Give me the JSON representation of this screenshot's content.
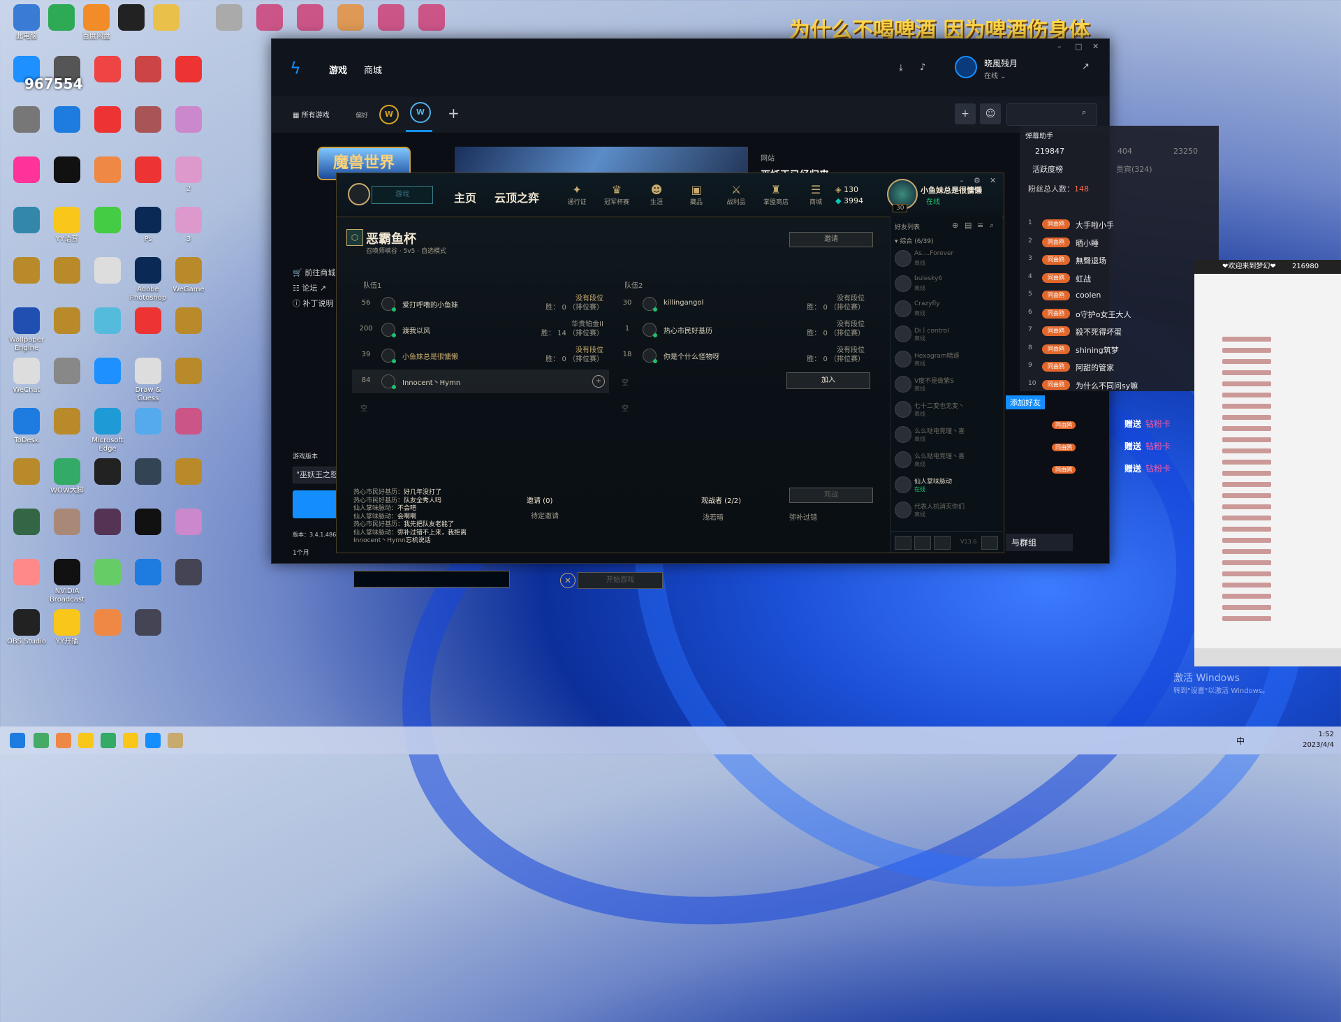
{
  "overlay": {
    "title": "为什么不喝啤酒 因为啤酒伤身体",
    "watermark": "967554"
  },
  "desktop_icons": [
    {
      "label": "此电脑",
      "color": "#3a7bd5"
    },
    {
      "label": "",
      "color": "#2eaa55"
    },
    {
      "label": "百度网盘",
      "color": "#f28c28"
    },
    {
      "label": "",
      "color": "#222"
    },
    {
      "label": "",
      "color": "#e8c04a"
    },
    {
      "label": "",
      "color": "#aaa"
    },
    {
      "label": "",
      "color": "#c58"
    },
    {
      "label": "",
      "color": "#c58"
    },
    {
      "label": "",
      "color": "#d95"
    },
    {
      "label": "",
      "color": "#c58"
    },
    {
      "label": "",
      "color": "#c58"
    },
    {
      "label": "",
      "color": "#687"
    },
    {
      "label": "",
      "color": "#1e90ff"
    },
    {
      "label": "",
      "color": "#555"
    },
    {
      "label": "",
      "color": "#e44"
    },
    {
      "label": "",
      "color": "#c44"
    },
    {
      "label": "",
      "color": "#e33"
    },
    {
      "label": "",
      "color": "#777"
    },
    {
      "label": "",
      "color": "#1e7be0"
    },
    {
      "label": "",
      "color": "#e33"
    },
    {
      "label": "",
      "color": "#a55"
    },
    {
      "label": "",
      "color": "#c8c"
    },
    {
      "label": "",
      "color": "#f39"
    },
    {
      "label": "",
      "color": "#111"
    },
    {
      "label": "",
      "color": "#e84"
    },
    {
      "label": "",
      "color": "#e33"
    },
    {
      "label": "2",
      "color": "#d9c"
    },
    {
      "label": "",
      "color": "#38a"
    },
    {
      "label": "YY语音",
      "color": "#f8c71a"
    },
    {
      "label": "",
      "color": "#4c4"
    },
    {
      "label": "Ps",
      "color": "#0a2a55"
    },
    {
      "label": "3",
      "color": "#d9c"
    },
    {
      "label": "",
      "color": "#b98a2a"
    },
    {
      "label": "",
      "color": "#b98a2a"
    },
    {
      "label": "",
      "color": "#ddd"
    },
    {
      "label": "Adobe Photoshop",
      "color": "#0a2a55"
    },
    {
      "label": "WeGame",
      "color": "#b98a2a"
    },
    {
      "label": "Wallpaper Engine",
      "color": "#1f4fb0"
    },
    {
      "label": "",
      "color": "#b98a2a"
    },
    {
      "label": "",
      "color": "#5bd"
    },
    {
      "label": "",
      "color": "#e33"
    },
    {
      "label": "",
      "color": "#b98a2a"
    },
    {
      "label": "WeChat",
      "color": "#ddd"
    },
    {
      "label": "",
      "color": "#888"
    },
    {
      "label": "",
      "color": "#1e90ff"
    },
    {
      "label": "Draw & Guess",
      "color": "#ddd"
    },
    {
      "label": "",
      "color": "#b98a2a"
    },
    {
      "label": "ToDesk",
      "color": "#1e7be0"
    },
    {
      "label": "",
      "color": "#b98a2a"
    },
    {
      "label": "Microsoft Edge",
      "color": "#1e9bd7"
    },
    {
      "label": "",
      "color": "#5ae"
    },
    {
      "label": "",
      "color": "#c58"
    },
    {
      "label": "",
      "color": "#b98a2a"
    },
    {
      "label": "WOW大脚",
      "color": "#3a6"
    },
    {
      "label": "",
      "color": "#222"
    },
    {
      "label": "",
      "color": "#345"
    },
    {
      "label": "",
      "color": "#b98a2a"
    },
    {
      "label": "",
      "color": "#364"
    },
    {
      "label": "",
      "color": "#a87"
    },
    {
      "label": "",
      "color": "#535"
    },
    {
      "label": "",
      "color": "#111"
    },
    {
      "label": "",
      "color": "#c8c"
    },
    {
      "label": "",
      "color": "#f88"
    },
    {
      "label": "NVIDIA Broadcast",
      "color": "#111"
    },
    {
      "label": "",
      "color": "#6c6"
    },
    {
      "label": "",
      "color": "#1e7be0"
    },
    {
      "label": "",
      "color": "#445"
    },
    {
      "label": "OBS Studio",
      "color": "#222"
    },
    {
      "label": "YY开播",
      "color": "#f8c71a"
    },
    {
      "label": "",
      "color": "#e84"
    },
    {
      "label": "",
      "color": "#445"
    }
  ],
  "bnet": {
    "nav_games": "游戏",
    "nav_shop": "商城",
    "username": "晓風残月",
    "status": "在线 ⌄",
    "tab_all": "所有游戏",
    "tab_fav": "偏好",
    "game_title": "魔兽世界",
    "side_links": [
      "前往商城",
      "论坛 ↗",
      "补丁说明"
    ],
    "news_label": "网站",
    "news_title": "巫妖王已经归来",
    "version_label": "游戏版本",
    "version_select": "\"巫妖王之怒",
    "version_num": "版本：3.4.1.486",
    "time_label": "1个月"
  },
  "lol": {
    "play_label": "游戏",
    "nav_home": "主页",
    "nav_tft": "云顶之弈",
    "icons": [
      {
        "glyph": "✦",
        "label": "通行证",
        "name": "pass-icon"
      },
      {
        "glyph": "♛",
        "label": "冠军杯赛",
        "name": "clash-icon"
      },
      {
        "glyph": "☻",
        "label": "生涯",
        "name": "profile-icon"
      },
      {
        "glyph": "▣",
        "label": "藏品",
        "name": "collection-icon"
      },
      {
        "glyph": "⚔",
        "label": "战利品",
        "name": "loot-icon"
      },
      {
        "glyph": "♜",
        "label": "掌盟商店",
        "name": "store-icon"
      },
      {
        "glyph": "☰",
        "label": "商城",
        "name": "shop-icon"
      }
    ],
    "currency": {
      "rp": "130",
      "be": "3994"
    },
    "profile": {
      "level": "30",
      "name": "小鱼妹总是很慵懒",
      "status": "在线"
    },
    "lobby": {
      "title": "恶霸鱼杯",
      "subtitle": "召唤师峡谷 · 5v5 · 自选模式",
      "invite": "邀请",
      "team1": "队伍1",
      "team2": "队伍2",
      "team1_slots": [
        {
          "level": "56",
          "name": "爱打呼噜的小鱼妹",
          "rank": "没有段位",
          "wins": "胜： 0 （排位赛）",
          "gold": false,
          "rank_gold": true
        },
        {
          "level": "200",
          "name": "渡我以风",
          "rank": "华贵铂金II",
          "wins": "胜： 14 （排位赛）",
          "gold": false,
          "rank_gold": false
        },
        {
          "level": "39",
          "name": "小鱼妹总是很慵懒",
          "rank": "没有段位",
          "wins": "胜： 0 （排位赛）",
          "gold": true,
          "rank_gold": true
        },
        {
          "level": "84",
          "name": "Innocent丶Hymn",
          "rank": "",
          "wins": "",
          "gold": false,
          "rank_gold": false
        }
      ],
      "team2_slots": [
        {
          "level": "30",
          "name": "killingangol",
          "rank": "没有段位",
          "wins": "胜： 0 （排位赛）"
        },
        {
          "level": "1",
          "name": "热心市民好基历",
          "rank": "没有段位",
          "wins": "胜： 0 （排位赛）"
        },
        {
          "level": "18",
          "name": "你是个什么怪物呀",
          "rank": "没有段位",
          "wins": "胜： 0 （排位赛）"
        }
      ],
      "empty": "空",
      "join": "加入",
      "chat": [
        {
          "n": "热心市民好基历：",
          "t": "好几年没打了"
        },
        {
          "n": "热心市民好基历：",
          "t": "队友全秀人吗"
        },
        {
          "n": "仙人掌味脉动：",
          "t": "不会吧"
        },
        {
          "n": "仙人掌味脉动：",
          "t": "会啊啊"
        },
        {
          "n": "热心市民好基历：",
          "t": "我先把队友老能了"
        },
        {
          "n": "仙人掌味脉动：",
          "t": "弥补过错不上来，我拒离"
        },
        {
          "n": "Innocent丶Hymn",
          "t": "忘机说话"
        }
      ],
      "invites_title": "邀请 (0)",
      "pending": "待定邀请",
      "spectators_title": "观战者 (2/2)",
      "spectate_btn": "观战",
      "spectators": [
        "浅若暗",
        "弥补过错"
      ],
      "start_btn": "开始游戏"
    },
    "friends": {
      "title": "好友列表",
      "group": "▾ 综合 (6/39)",
      "list": [
        {
          "name": "As....Forever",
          "status": "离线",
          "online": false
        },
        {
          "name": "bulesky6",
          "status": "离线",
          "online": false
        },
        {
          "name": "Crazyfly",
          "status": "离线",
          "online": false
        },
        {
          "name": "Di丨control",
          "status": "离线",
          "online": false
        },
        {
          "name": "Hexagram暗遥",
          "status": "离线",
          "online": false
        },
        {
          "name": "V度不是做紫S",
          "status": "离线",
          "online": false
        },
        {
          "name": "七十二变也无变丶",
          "status": "离线",
          "online": false
        },
        {
          "name": "么么哒电竞瑾丶喜",
          "status": "离线",
          "online": false
        },
        {
          "name": "么么哒电竞瑾丶喜",
          "status": "离线",
          "online": false
        },
        {
          "name": "仙人掌味脉动",
          "status": "在线",
          "online": true
        },
        {
          "name": "代表人机消灭你们",
          "status": "离线",
          "online": false
        }
      ],
      "version": "V13.6"
    }
  },
  "live": {
    "title": "弹幕助手",
    "stats": [
      "219847",
      "404",
      "23250"
    ],
    "tab1": "活跃度榜",
    "tab2": "贵宾(324)",
    "fans_label": "粉丝总人数：",
    "fans_count": "148",
    "badge": "同由鸥",
    "users": [
      "大手啦小手",
      "晒小睡",
      "無聲退场",
      "虹战",
      "coolen",
      "o守护o女王大人",
      "殺不死得坏蛋",
      "shining筑梦",
      "阿甜的管家",
      "为什么不同问sy嘛"
    ],
    "gift_action": "赠送",
    "gift_item": "钻粉卡",
    "add_friend": "添加好友",
    "group_chat": "与群组",
    "obs_top": "❤欢迎来到梦幻❤",
    "obs_num": "216980"
  },
  "windows": {
    "activate1": "激活 Windows",
    "activate2": "转到\"设置\"以激活 Windows。",
    "time": "1:52",
    "date": "2023/4/4",
    "ime": "中"
  }
}
